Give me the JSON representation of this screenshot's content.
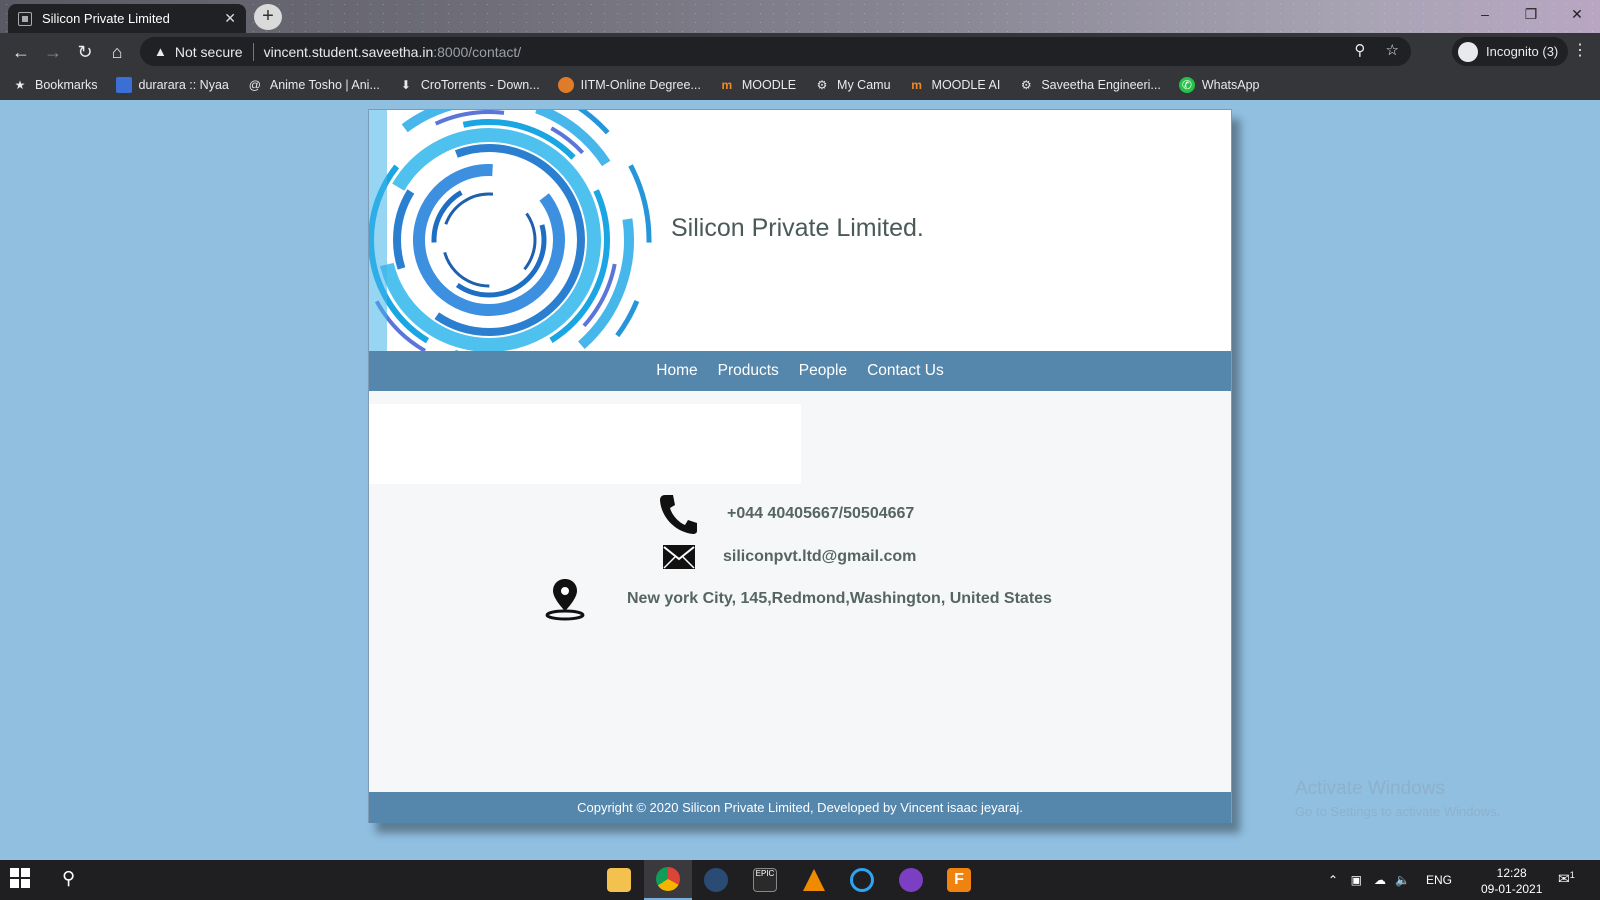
{
  "browser": {
    "tab_title": "Silicon Private Limited",
    "tab_close": "✕",
    "new_tab": "+",
    "security_label": "Not secure",
    "url_host": "vincent.student.saveetha.in",
    "url_path": ":8000/contact/",
    "incognito_label": "Incognito (3)",
    "bookmarks": [
      {
        "label": "Bookmarks",
        "icon": "star-icon"
      },
      {
        "label": "durarara :: Nyaa",
        "icon": "nyaa-icon"
      },
      {
        "label": "Anime Tosho | Ani...",
        "icon": "at-icon"
      },
      {
        "label": "CroTorrents - Down...",
        "icon": "download-icon"
      },
      {
        "label": "IITM-Online Degree...",
        "icon": "iitm-icon"
      },
      {
        "label": "MOODLE",
        "icon": "moodle-icon"
      },
      {
        "label": "My Camu",
        "icon": "globe-icon"
      },
      {
        "label": "MOODLE AI",
        "icon": "moodle-icon"
      },
      {
        "label": "Saveetha Engineeri...",
        "icon": "globe-icon"
      },
      {
        "label": "WhatsApp",
        "icon": "whatsapp-icon"
      }
    ]
  },
  "site": {
    "company_name": "Silicon Private Limited.",
    "nav": [
      "Home",
      "Products",
      "People",
      "Contact Us"
    ],
    "contact": {
      "phone": "+044 40405667/50504667",
      "email": "siliconpvt.ltd@gmail.com",
      "address": "New york City, 145,Redmond,Washington, United States"
    },
    "footer": "Copyright © 2020 Silicon Private Limited, Developed by Vincent isaac jeyaraj."
  },
  "watermark": {
    "line1": "Activate Windows",
    "line2": "Go to Settings to activate Windows."
  },
  "taskbar": {
    "language": "ENG",
    "time": "12:28",
    "date": "09-01-2021",
    "notifications": "1"
  }
}
